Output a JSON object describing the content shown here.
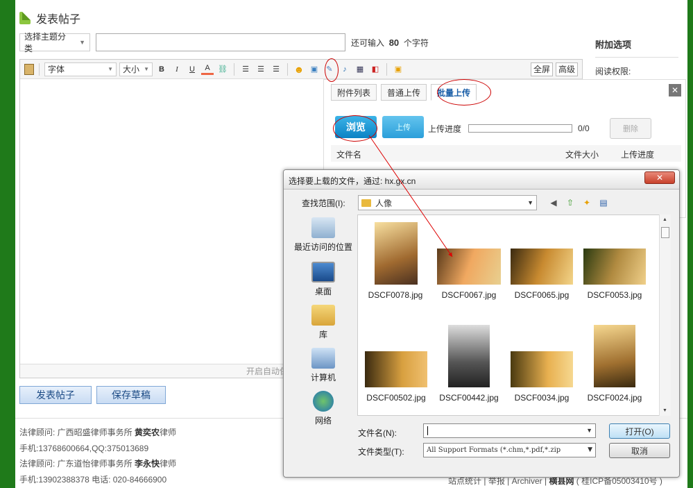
{
  "header": {
    "title": "发表帖子"
  },
  "form": {
    "category_select": "选择主题分类",
    "subject_value": "",
    "remaining_prefix": "还可输入",
    "remaining_count": "80",
    "remaining_suffix": "个字符"
  },
  "toolbar": {
    "font_select": "字体",
    "size_select": "大小",
    "bold": "B",
    "italic": "I",
    "underline": "U",
    "fontcolor": "A",
    "fullscreen": "全屏",
    "advanced": "高级"
  },
  "editor": {
    "status": "开启自动保"
  },
  "buttons": {
    "submit": "发表帖子",
    "draft": "保存草稿"
  },
  "extras": {
    "title": "附加选项",
    "read_perm": "阅读权限:"
  },
  "footer": {
    "line1_prefix": "法律顾问: 广西昭盛律师事务所",
    "line1_name": "黄奕农",
    "line1_suffix": "律师",
    "line2": "手机:13768600664,QQ:375013689",
    "line3_prefix": "法律顾问: 广东道怡律师事务所",
    "line3_name": "李永快",
    "line3_suffix": "律师",
    "line4": "手机:13902388378 电话: 020-84666900",
    "links": {
      "stats": "站点统计",
      "report": "举报",
      "archiver": "Archiver",
      "site": "横县网",
      "icp": "( 桂ICP备05003410号 )"
    }
  },
  "upload_panel": {
    "tabs": [
      "附件列表",
      "普通上传",
      "批量上传"
    ],
    "active_tab": "批量上传",
    "close": "✕",
    "browse": "浏览",
    "upload": "上传",
    "progress_label": "上传进度",
    "progress_count": "0/0",
    "progress_fraction": 0,
    "delete": "删除",
    "col_name": "文件名",
    "col_size": "文件大小",
    "col_progress": "上传进度"
  },
  "dialog": {
    "title": "选择要上载的文件，通过: hx.gx.cn",
    "close": "✕",
    "lookin_label": "查找范围(I):",
    "lookin_value": "人像",
    "places": [
      "最近访问的位置",
      "桌面",
      "库",
      "计算机",
      "网络"
    ],
    "files": [
      "DSCF0078.jpg",
      "DSCF0067.jpg",
      "DSCF0065.jpg",
      "DSCF0053.jpg",
      "DSCF00502.jpg",
      "DSCF00442.jpg",
      "DSCF0034.jpg",
      "DSCF0024.jpg"
    ],
    "filename_label": "文件名(N):",
    "filename_value": "",
    "filetype_label": "文件类型(T):",
    "filetype_value": "All Support Formats (*.chm,*.pdf,*.zip",
    "open": "打开(O)",
    "cancel": "取消"
  },
  "icons": {
    "paste": "paste-icon",
    "emoji": "emoji-icon",
    "image": "image-icon",
    "attachment": "attachment-icon",
    "music": "music-icon",
    "video": "video-icon",
    "flash": "flash-icon"
  }
}
